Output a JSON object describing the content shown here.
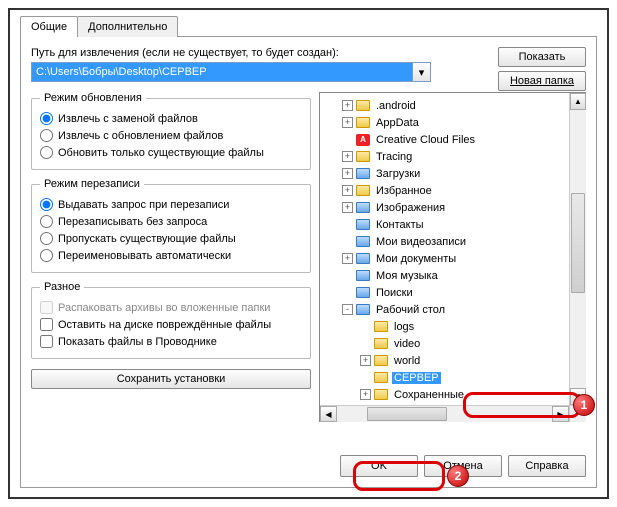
{
  "tabs": {
    "general": "Общие",
    "advanced": "Дополнительно"
  },
  "path": {
    "label": "Путь для извлечения (если не существует, то будет создан):",
    "value": "C:\\Users\\Бобры\\Desktop\\СЕРВЕР"
  },
  "buttons": {
    "show": "Показать",
    "newfolder": "Новая папка",
    "savesettings": "Сохранить установки",
    "ok": "OK",
    "cancel": "Отмена",
    "help": "Справка"
  },
  "groups": {
    "update": {
      "title": "Режим обновления",
      "opt1": "Извлечь с заменой файлов",
      "opt2": "Извлечь с обновлением файлов",
      "opt3": "Обновить только существующие файлы"
    },
    "overwrite": {
      "title": "Режим перезаписи",
      "opt1": "Выдавать запрос при перезаписи",
      "opt2": "Перезаписывать без запроса",
      "opt3": "Пропускать существующие файлы",
      "opt4": "Переименовывать автоматически"
    },
    "misc": {
      "title": "Разное",
      "opt1": "Распаковать архивы во вложенные папки",
      "opt2": "Оставить на диске повреждённые файлы",
      "opt3": "Показать файлы в Проводнике"
    }
  },
  "tree": {
    "items": [
      {
        "label": ".android",
        "level": 1,
        "exp": "+",
        "icon": "folder"
      },
      {
        "label": "AppData",
        "level": 1,
        "exp": "+",
        "icon": "folder"
      },
      {
        "label": "Creative Cloud Files",
        "level": 1,
        "exp": "",
        "icon": "adobe"
      },
      {
        "label": "Tracing",
        "level": 1,
        "exp": "+",
        "icon": "folder"
      },
      {
        "label": "Загрузки",
        "level": 1,
        "exp": "+",
        "icon": "folder-blue"
      },
      {
        "label": "Избранное",
        "level": 1,
        "exp": "+",
        "icon": "folder-star"
      },
      {
        "label": "Изображения",
        "level": 1,
        "exp": "+",
        "icon": "folder-blue"
      },
      {
        "label": "Контакты",
        "level": 1,
        "exp": "",
        "icon": "folder-blue"
      },
      {
        "label": "Мои видеозаписи",
        "level": 1,
        "exp": "",
        "icon": "folder-blue"
      },
      {
        "label": "Мои документы",
        "level": 1,
        "exp": "+",
        "icon": "folder-blue"
      },
      {
        "label": "Моя музыка",
        "level": 1,
        "exp": "",
        "icon": "folder-blue"
      },
      {
        "label": "Поиски",
        "level": 1,
        "exp": "",
        "icon": "folder-blue"
      },
      {
        "label": "Рабочий стол",
        "level": 1,
        "exp": "-",
        "icon": "folder-blue"
      },
      {
        "label": "logs",
        "level": 2,
        "exp": "",
        "icon": "folder"
      },
      {
        "label": "video",
        "level": 2,
        "exp": "",
        "icon": "folder"
      },
      {
        "label": "world",
        "level": 2,
        "exp": "+",
        "icon": "folder"
      },
      {
        "label": "СЕРВЕР",
        "level": 2,
        "exp": "",
        "icon": "folder",
        "selected": true
      },
      {
        "label": "Сохраненные",
        "level": 2,
        "exp": "+",
        "icon": "folder"
      }
    ]
  },
  "annotations": {
    "badge1": "1",
    "badge2": "2"
  }
}
